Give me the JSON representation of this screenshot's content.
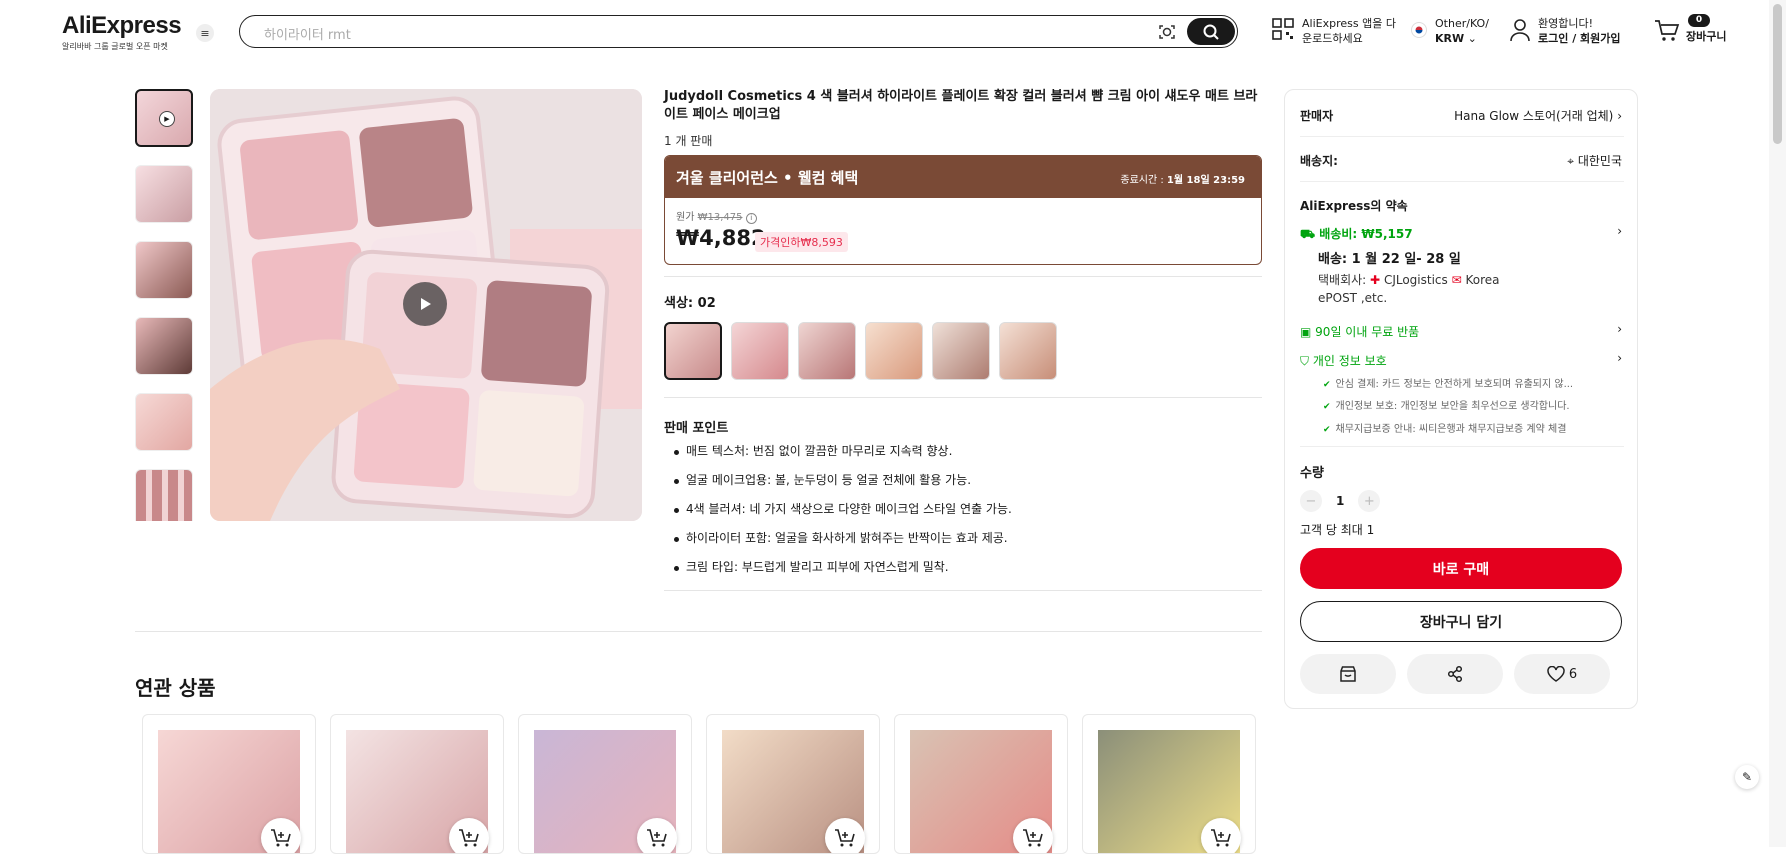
{
  "header": {
    "logo": "AliExpress",
    "logo_tagline": "알리바바 그룹 글로벌 오픈 마켓",
    "search_placeholder": "하이라이터 rmt",
    "app_line1": "AliExpress 앱을 다",
    "app_line2": "운로드하세요",
    "region_line1": "Other/KO/",
    "region_line2": "KRW",
    "welcome": "환영합니다!",
    "login": "로그인 / 회원가입",
    "cart_count": "0",
    "cart_label": "장바구니"
  },
  "product": {
    "title": "Judydoll Cosmetics 4 색 블러셔 하이라이트 플레이트 확장 컬러 블러셔 뺨 크림 아이 섀도우 매트 브라이트 페이스 메이크업",
    "sold": "1 개 판매",
    "promo_title": "겨울 클리어런스 • 웰컴 혜택",
    "promo_end_label": "종료시간 :",
    "promo_end": "1월 18일 23:59",
    "orig_label": "원가",
    "orig_price": "₩13,475",
    "price": "₩4,882",
    "discount": "가격인하₩8,593",
    "color_label": "색상: 02",
    "points_title": "판매 포인트",
    "points": [
      "매트 텍스처: 번짐 없이 깔끔한 마무리로 지속력 향상.",
      "얼굴 메이크업용: 볼, 눈두덩이 등 얼굴 전체에 활용 가능.",
      "4색 블러셔: 네 가지 색상으로 다양한 메이크업 스타일 연출 가능.",
      "하이라이터 포함: 얼굴을 화사하게 밝혀주는 반짝이는 효과 제공.",
      "크림 타입: 부드럽게 발리고 피부에 자연스럽게 밀착."
    ]
  },
  "related": {
    "title": "연관 상품"
  },
  "sidebar": {
    "seller_label": "판매자",
    "seller_name": "Hana Glow 스토어(거래 업체)",
    "ship_to_label": "배송지:",
    "ship_to": "대한민국",
    "promise_title": "AliExpress의 약속",
    "shipping_fee": "배송비: ₩5,157",
    "delivery": "배송: 1 월 22 일- 28 일",
    "carrier_label": "택배회사:",
    "carrier1": "CJLogistics",
    "carrier2": "Korea",
    "carrier3": "ePOST ,etc.",
    "returns": "90일 이내 무료 반품",
    "privacy": "개인 정보 보호",
    "privacy_items": [
      "안심 결제: 카드 정보는 안전하게 보호되며 유출되지 않...",
      "개인정보 보호: 개인정보 보안을 최우선으로 생각합니다.",
      "채무지급보증 안내: 씨티은행과 채무지급보증 계약 체결"
    ],
    "qty_label": "수량",
    "qty": "1",
    "qty_limit": "고객 당 최대 1",
    "buy_now": "바로 구매",
    "add_to_cart": "장바구니 담기",
    "wish_count": "6"
  },
  "colors": {
    "accent_red": "#e4001e",
    "promo_brown": "#7a4a36",
    "green": "#00a40f"
  }
}
